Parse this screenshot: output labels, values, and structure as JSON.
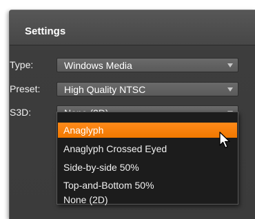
{
  "settings": {
    "title": "Settings",
    "rows": [
      {
        "label": "Type:",
        "value": "Windows Media"
      },
      {
        "label": "Preset:",
        "value": "High Quality NTSC"
      },
      {
        "label": "S3D:",
        "value": "None (2D)"
      }
    ],
    "s3d_options": [
      "Anaglyph",
      "Anaglyph Crossed Eyed",
      "Side-by-side 50%",
      "Top-and-Bottom 50%",
      "None (2D)"
    ],
    "highlighted_option": "Anaglyph"
  },
  "colors": {
    "panel_bg": "#3d3d3d",
    "highlight": "#f07800"
  }
}
